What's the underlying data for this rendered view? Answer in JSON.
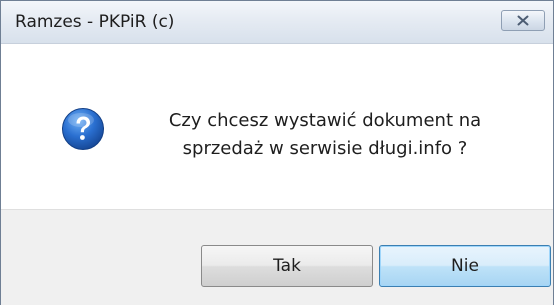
{
  "window": {
    "title": "Ramzes - PKPiR (c)"
  },
  "dialog": {
    "icon": "question-icon",
    "message_line1": "Czy chcesz wystawić dokument na",
    "message_line2": "sprzedaż w serwisie długi.info ?"
  },
  "buttons": {
    "yes_label": "Tak",
    "no_label": "Nie"
  },
  "colors": {
    "icon_blue": "#2a6fd0",
    "default_button_border": "#3c7fb1"
  }
}
